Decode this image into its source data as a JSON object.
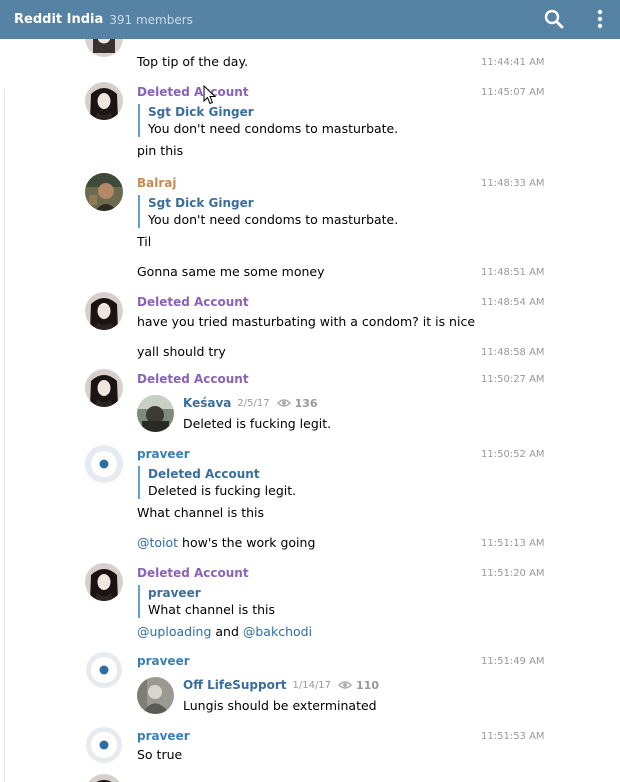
{
  "header": {
    "title": "Reddit India",
    "members": "391 members",
    "search_icon": "search-icon",
    "more_icon": "vertical-dots-icon",
    "bg": "#5682a3"
  },
  "colors": {
    "deleted_account": "#8a63b8",
    "balraj": "#c98a4c",
    "praveer": "#3a7fb3",
    "reply_bar": "#5e9fd6",
    "mention": "#2f6ea5"
  },
  "messages": {
    "m1": {
      "text": "Top tip of the day.",
      "time": "11:44:41 AM"
    },
    "m2": {
      "author": "Deleted Account",
      "time": "11:45:07 AM",
      "reply_name": "Sgt Dick Ginger",
      "reply_text": "You don't need condoms to masturbate.",
      "text": "pin this"
    },
    "m3": {
      "author": "Balraj",
      "time": "11:48:33 AM",
      "reply_name": "Sgt Dick Ginger",
      "reply_text": "You don't need condoms to masturbate.",
      "text": "Til"
    },
    "m4": {
      "text": "Gonna same me some money",
      "time": "11:48:51 AM"
    },
    "m5": {
      "author": "Deleted Account",
      "time": "11:48:54 AM",
      "text": "have you tried masturbating with a condom? it is nice"
    },
    "m6": {
      "text": "yall should try",
      "time": "11:48:58 AM"
    },
    "m7": {
      "author": "Deleted Account",
      "time": "11:50:27 AM",
      "fwd_name": "Keśava",
      "fwd_date": "2/5/17",
      "fwd_views": "136",
      "fwd_text": "Deleted is fucking legit."
    },
    "m8": {
      "author": "praveer",
      "time": "11:50:52 AM",
      "reply_name": "Deleted Account",
      "reply_text": "Deleted is fucking legit.",
      "text": "What channel is this"
    },
    "m9": {
      "mention": "@toiot",
      "text": " how's the work going",
      "time": "11:51:13 AM"
    },
    "m10": {
      "author": "Deleted Account",
      "time": "11:51:20 AM",
      "reply_name": "praveer",
      "reply_text": "What channel is this",
      "mention1": "@uploading",
      "and": " and ",
      "mention2": "@bakchodi"
    },
    "m11": {
      "author": "praveer",
      "time": "11:51:49 AM",
      "fwd_name": "Off LifeSupport",
      "fwd_date": "1/14/17",
      "fwd_views": "110",
      "fwd_text": "Lungis should be exterminated"
    },
    "m12": {
      "author": "praveer",
      "time": "11:51:53 AM",
      "text": "So true"
    }
  }
}
